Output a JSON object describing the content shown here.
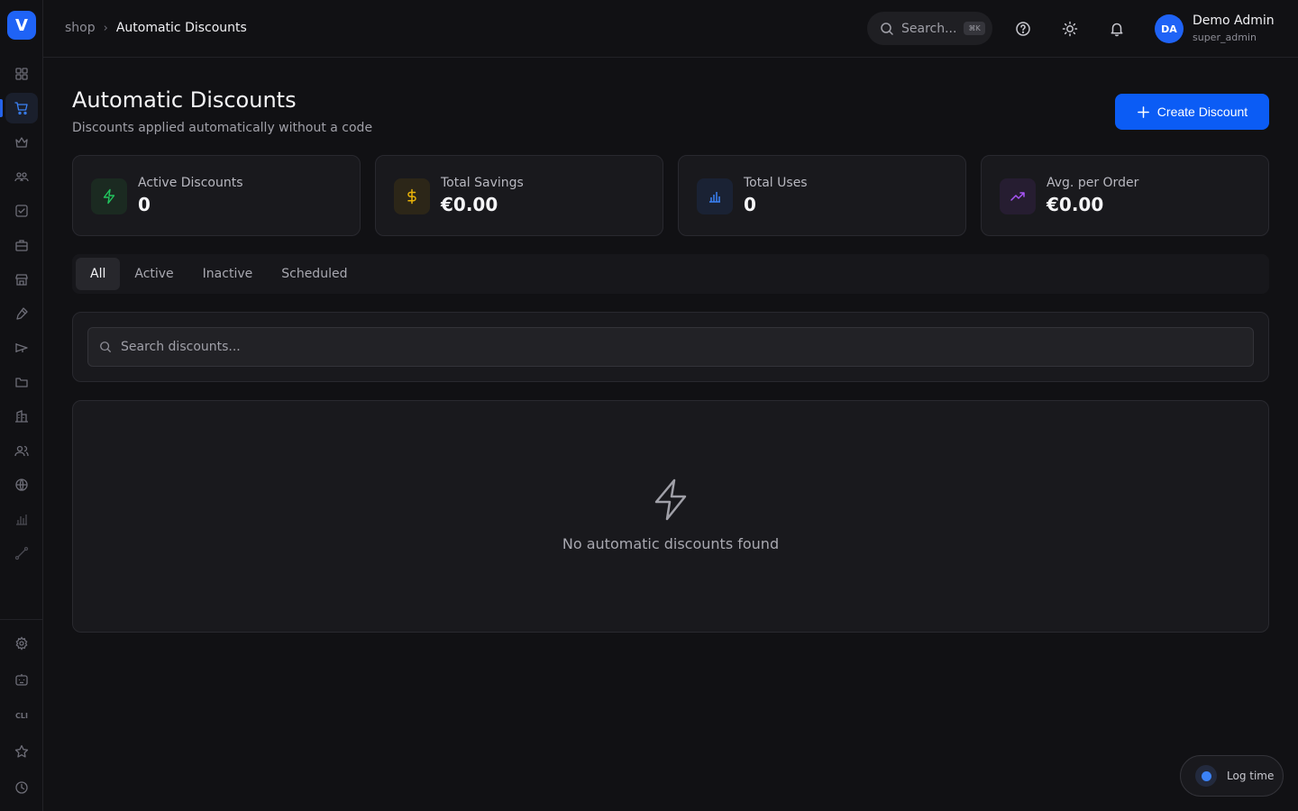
{
  "app": {
    "logo_letter": "V"
  },
  "breadcrumb": {
    "root": "shop",
    "current": "Automatic Discounts"
  },
  "topbar": {
    "search_label": "Search...",
    "search_shortcut": "⌘K",
    "user_initials": "DA",
    "user_name": "Demo Admin",
    "user_role": "super_admin"
  },
  "page": {
    "title": "Automatic Discounts",
    "subtitle": "Discounts applied automatically without a code",
    "create_button": "Create Discount"
  },
  "stats": [
    {
      "label": "Active Discounts",
      "value": "0",
      "icon": "zap-icon",
      "color": "#22c55e"
    },
    {
      "label": "Total Savings",
      "value": "€0.00",
      "icon": "dollar-icon",
      "color": "#eab308"
    },
    {
      "label": "Total Uses",
      "value": "0",
      "icon": "bar-chart-icon",
      "color": "#3b82f6"
    },
    {
      "label": "Avg. per Order",
      "value": "€0.00",
      "icon": "trending-up-icon",
      "color": "#a855f7"
    }
  ],
  "tabs": [
    {
      "label": "All",
      "active": true
    },
    {
      "label": "Active"
    },
    {
      "label": "Inactive"
    },
    {
      "label": "Scheduled"
    }
  ],
  "search": {
    "placeholder": "Search discounts..."
  },
  "empty_state": {
    "message": "No automatic discounts found",
    "icon": "zap-icon"
  },
  "sidebar": {
    "items": [
      "dashboard-icon",
      "cart-icon",
      "crown-icon",
      "users-icon",
      "check-square-icon",
      "briefcase-icon",
      "store-icon",
      "pen-icon",
      "megaphone-icon",
      "folder-icon",
      "building-icon",
      "team-icon",
      "globe-icon",
      "bar-chart-icon",
      "route-icon"
    ],
    "bottom_items": [
      "settings-icon",
      "bot-icon",
      "cli-label",
      "star-icon",
      "clock-icon"
    ],
    "cli_label": "CLI"
  },
  "log_time": {
    "label": "Log time"
  },
  "colors": {
    "accent": "#0b5cf5",
    "background": "#111114",
    "card": "#19191d"
  }
}
